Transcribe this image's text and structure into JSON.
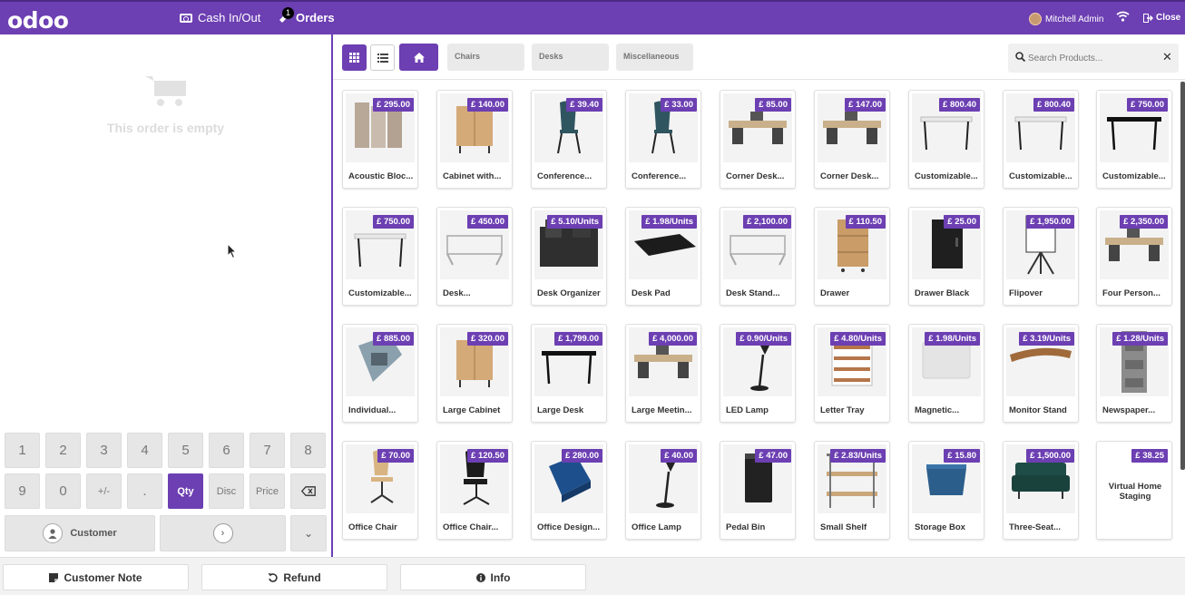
{
  "topbar": {
    "logo": "odoo",
    "cash_label": "Cash In/Out",
    "orders_label": "Orders",
    "orders_count": "1",
    "user_name": "Mitchell Admin",
    "close_label": "Close",
    "brand_color": "#6c3fb2"
  },
  "order": {
    "empty_text": "This order is empty"
  },
  "numpad": {
    "keys": [
      "1",
      "2",
      "3",
      "4",
      "5",
      "6",
      "7",
      "8",
      "9",
      "0",
      "+/-",
      ".",
      "Qty",
      "Disc",
      "Price"
    ],
    "active_mode": "Qty",
    "customer_label": "Customer"
  },
  "controls": {
    "categories": [
      "Chairs",
      "Desks",
      "Miscellaneous"
    ],
    "search_placeholder": "Search Products..."
  },
  "products": [
    {
      "name": "Acoustic Bloc...",
      "price": "£ 295.00",
      "thumb": "screen"
    },
    {
      "name": "Cabinet with...",
      "price": "£ 140.00",
      "thumb": "cabinet"
    },
    {
      "name": "Conference...",
      "price": "£ 39.40",
      "thumb": "chair-teal"
    },
    {
      "name": "Conference...",
      "price": "£ 33.00",
      "thumb": "chair-teal"
    },
    {
      "name": "Corner Desk...",
      "price": "£ 85.00",
      "thumb": "desk-set"
    },
    {
      "name": "Corner Desk...",
      "price": "£ 147.00",
      "thumb": "desk-set"
    },
    {
      "name": "Customizable...",
      "price": "£ 800.40",
      "thumb": "table-white"
    },
    {
      "name": "Customizable...",
      "price": "£ 800.40",
      "thumb": "table-white"
    },
    {
      "name": "Customizable...",
      "price": "£ 750.00",
      "thumb": "table-black"
    },
    {
      "name": "Customizable...",
      "price": "£ 750.00",
      "thumb": "table-white"
    },
    {
      "name": "Desk...",
      "price": "£ 450.00",
      "thumb": "desk-frame"
    },
    {
      "name": "Desk Organizer",
      "price": "£ 5.10/Units",
      "thumb": "organizer"
    },
    {
      "name": "Desk Pad",
      "price": "£ 1.98/Units",
      "thumb": "pad"
    },
    {
      "name": "Desk Stand...",
      "price": "£ 2,100.00",
      "thumb": "desk-frame"
    },
    {
      "name": "Drawer",
      "price": "£ 110.50",
      "thumb": "drawer-wood"
    },
    {
      "name": "Drawer Black",
      "price": "£ 25.00",
      "thumb": "drawer-black"
    },
    {
      "name": "Flipover",
      "price": "£ 1,950.00",
      "thumb": "flipover"
    },
    {
      "name": "Four Person...",
      "price": "£ 2,350.00",
      "thumb": "desk-set"
    },
    {
      "name": "Individual...",
      "price": "£ 885.00",
      "thumb": "pod"
    },
    {
      "name": "Large Cabinet",
      "price": "£ 320.00",
      "thumb": "cabinet"
    },
    {
      "name": "Large Desk",
      "price": "£ 1,799.00",
      "thumb": "table-black"
    },
    {
      "name": "Large Meetin...",
      "price": "£ 4,000.00",
      "thumb": "desk-set"
    },
    {
      "name": "LED Lamp",
      "price": "£ 0.90/Units",
      "thumb": "lamp"
    },
    {
      "name": "Letter Tray",
      "price": "£ 4.80/Units",
      "thumb": "tray"
    },
    {
      "name": "Magnetic...",
      "price": "£ 1.98/Units",
      "thumb": "board"
    },
    {
      "name": "Monitor Stand",
      "price": "£ 3.19/Units",
      "thumb": "stand"
    },
    {
      "name": "Newspaper...",
      "price": "£ 1.28/Units",
      "thumb": "rack"
    },
    {
      "name": "Office Chair",
      "price": "£ 70.00",
      "thumb": "chair-office"
    },
    {
      "name": "Office Chair...",
      "price": "£ 120.50",
      "thumb": "chair-black"
    },
    {
      "name": "Office Design...",
      "price": "£ 280.00",
      "thumb": "box-blue"
    },
    {
      "name": "Office Lamp",
      "price": "£ 40.00",
      "thumb": "lamp"
    },
    {
      "name": "Pedal Bin",
      "price": "£ 47.00",
      "thumb": "bin"
    },
    {
      "name": "Small Shelf",
      "price": "£ 2.83/Units",
      "thumb": "shelf"
    },
    {
      "name": "Storage Box",
      "price": "£ 15.80",
      "thumb": "storage"
    },
    {
      "name": "Three-Seat...",
      "price": "£ 1,500.00",
      "thumb": "sofa"
    },
    {
      "name": "Virtual Home Staging",
      "price": "£ 38.25",
      "thumb": "none"
    }
  ],
  "bottom": {
    "customer_note": "Customer Note",
    "refund": "Refund",
    "info": "Info"
  }
}
